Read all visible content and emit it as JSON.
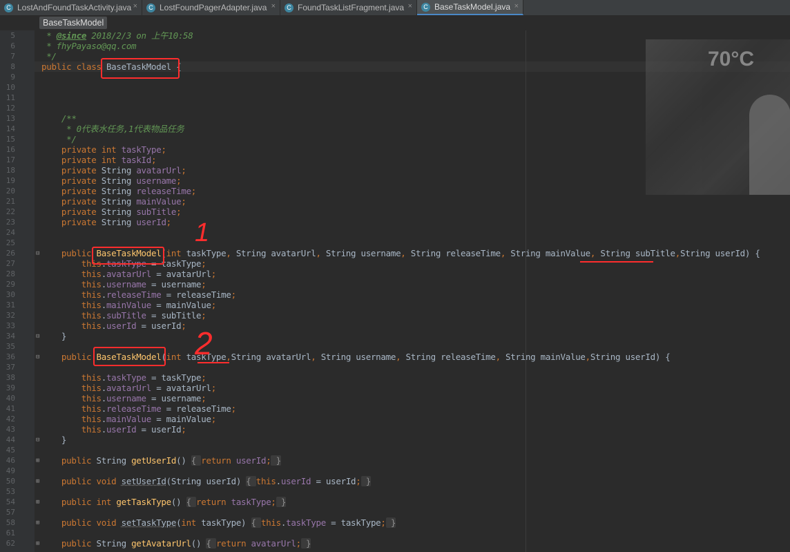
{
  "tabs": [
    {
      "label": "LostAndFoundTaskActivity.java",
      "icon": "C",
      "active": false
    },
    {
      "label": "LostFoundPagerAdapter.java",
      "icon": "C",
      "active": false
    },
    {
      "label": "FoundTaskListFragment.java",
      "icon": "C",
      "active": false
    },
    {
      "label": "BaseTaskModel.java",
      "icon": "C",
      "active": true
    }
  ],
  "tab_close_icon": "×",
  "breadcrumb": "BaseTaskModel",
  "background_image_text": "70°C",
  "annotations": {
    "mark_one": "1",
    "mark_two": "2"
  },
  "colors": {
    "keyword": "#cc7832",
    "field": "#9876aa",
    "method": "#ffc66d",
    "comment": "#629755",
    "annotation": "#ff2d2d"
  },
  "code_lines": [
    {
      "n": "5",
      "segs": [
        [
          "cm",
          " * "
        ],
        [
          "cmt",
          "@since"
        ],
        [
          "cm",
          " 2018/2/3 on 上午10:58"
        ]
      ]
    },
    {
      "n": "6",
      "segs": [
        [
          "cm",
          " * fhyPayaso@qq.com"
        ]
      ]
    },
    {
      "n": "7",
      "segs": [
        [
          "cm",
          " */"
        ]
      ]
    },
    {
      "n": "8",
      "segs": [
        [
          "kw",
          "public class "
        ],
        [
          "",
          "BaseTaskModel {"
        ]
      ]
    },
    {
      "n": "9",
      "segs": []
    },
    {
      "n": "10",
      "segs": []
    },
    {
      "n": "11",
      "segs": []
    },
    {
      "n": "12",
      "segs": []
    },
    {
      "n": "13",
      "segs": [
        [
          "cm",
          "    /**"
        ]
      ]
    },
    {
      "n": "14",
      "segs": [
        [
          "cm",
          "     * 0代表水任务,1代表物品任务"
        ]
      ]
    },
    {
      "n": "15",
      "segs": [
        [
          "cm",
          "     */"
        ]
      ]
    },
    {
      "n": "16",
      "segs": [
        [
          "kw",
          "    private int "
        ],
        [
          "fld",
          "taskType"
        ],
        [
          "kw",
          ";"
        ]
      ]
    },
    {
      "n": "17",
      "segs": [
        [
          "kw",
          "    private int "
        ],
        [
          "fld",
          "taskId"
        ],
        [
          "kw",
          ";"
        ]
      ]
    },
    {
      "n": "18",
      "segs": [
        [
          "kw",
          "    private "
        ],
        [
          "",
          "String "
        ],
        [
          "fld",
          "avatarUrl"
        ],
        [
          "kw",
          ";"
        ]
      ]
    },
    {
      "n": "19",
      "segs": [
        [
          "kw",
          "    private "
        ],
        [
          "",
          "String "
        ],
        [
          "fld",
          "username"
        ],
        [
          "kw",
          ";"
        ]
      ]
    },
    {
      "n": "20",
      "segs": [
        [
          "kw",
          "    private "
        ],
        [
          "",
          "String "
        ],
        [
          "fld",
          "releaseTime"
        ],
        [
          "kw",
          ";"
        ]
      ]
    },
    {
      "n": "21",
      "segs": [
        [
          "kw",
          "    private "
        ],
        [
          "",
          "String "
        ],
        [
          "fld",
          "mainValue"
        ],
        [
          "kw",
          ";"
        ]
      ]
    },
    {
      "n": "22",
      "segs": [
        [
          "kw",
          "    private "
        ],
        [
          "",
          "String "
        ],
        [
          "fld",
          "subTitle"
        ],
        [
          "kw",
          ";"
        ]
      ]
    },
    {
      "n": "23",
      "segs": [
        [
          "kw",
          "    private "
        ],
        [
          "",
          "String "
        ],
        [
          "fld",
          "userId"
        ],
        [
          "kw",
          ";"
        ]
      ]
    },
    {
      "n": "24",
      "segs": []
    },
    {
      "n": "25",
      "segs": []
    },
    {
      "n": "26",
      "segs": [
        [
          "kw",
          "    public "
        ],
        [
          "fn",
          "BaseTaskModel"
        ],
        [
          "",
          "("
        ],
        [
          "kw",
          "int "
        ],
        [
          "",
          "taskType"
        ],
        [
          "kw",
          ", "
        ],
        [
          "",
          "String avatarUrl"
        ],
        [
          "kw",
          ", "
        ],
        [
          "",
          "String username"
        ],
        [
          "kw",
          ", "
        ],
        [
          "",
          "String releaseTime"
        ],
        [
          "kw",
          ", "
        ],
        [
          "",
          "String mainValue"
        ],
        [
          "kw",
          ", "
        ],
        [
          "",
          "String subTitle"
        ],
        [
          "kw",
          ","
        ],
        [
          "",
          "String userId) {"
        ]
      ]
    },
    {
      "n": "27",
      "segs": [
        [
          "kw",
          "        this"
        ],
        [
          "",
          "."
        ],
        [
          "fld",
          "taskType"
        ],
        [
          "",
          " = taskType"
        ],
        [
          "kw",
          ";"
        ]
      ]
    },
    {
      "n": "28",
      "segs": [
        [
          "kw",
          "        this"
        ],
        [
          "",
          "."
        ],
        [
          "fld",
          "avatarUrl"
        ],
        [
          "",
          " = avatarUrl"
        ],
        [
          "kw",
          ";"
        ]
      ]
    },
    {
      "n": "29",
      "segs": [
        [
          "kw",
          "        this"
        ],
        [
          "",
          "."
        ],
        [
          "fld",
          "username"
        ],
        [
          "",
          " = username"
        ],
        [
          "kw",
          ";"
        ]
      ]
    },
    {
      "n": "30",
      "segs": [
        [
          "kw",
          "        this"
        ],
        [
          "",
          "."
        ],
        [
          "fld",
          "releaseTime"
        ],
        [
          "",
          " = releaseTime"
        ],
        [
          "kw",
          ";"
        ]
      ]
    },
    {
      "n": "31",
      "segs": [
        [
          "kw",
          "        this"
        ],
        [
          "",
          "."
        ],
        [
          "fld",
          "mainValue"
        ],
        [
          "",
          " = mainValue"
        ],
        [
          "kw",
          ";"
        ]
      ]
    },
    {
      "n": "32",
      "segs": [
        [
          "kw",
          "        this"
        ],
        [
          "",
          "."
        ],
        [
          "fld",
          "subTitle"
        ],
        [
          "",
          " = subTitle"
        ],
        [
          "kw",
          ";"
        ]
      ]
    },
    {
      "n": "33",
      "segs": [
        [
          "kw",
          "        this"
        ],
        [
          "",
          "."
        ],
        [
          "fld",
          "userId"
        ],
        [
          "",
          " = userId"
        ],
        [
          "kw",
          ";"
        ]
      ]
    },
    {
      "n": "34",
      "segs": [
        [
          "",
          "    }"
        ]
      ]
    },
    {
      "n": "35",
      "segs": []
    },
    {
      "n": "36",
      "segs": [
        [
          "kw",
          "    public "
        ],
        [
          "fn",
          "BaseTaskModel"
        ],
        [
          "",
          "("
        ],
        [
          "kw",
          "int "
        ],
        [
          "",
          "taskType"
        ],
        [
          "kw",
          ","
        ],
        [
          "",
          "String avatarUrl"
        ],
        [
          "kw",
          ", "
        ],
        [
          "",
          "String username"
        ],
        [
          "kw",
          ", "
        ],
        [
          "",
          "String releaseTime"
        ],
        [
          "kw",
          ", "
        ],
        [
          "",
          "String mainValue"
        ],
        [
          "kw",
          ","
        ],
        [
          "",
          "String userId) {"
        ]
      ]
    },
    {
      "n": "37",
      "segs": []
    },
    {
      "n": "38",
      "segs": [
        [
          "kw",
          "        this"
        ],
        [
          "",
          "."
        ],
        [
          "fld",
          "taskType"
        ],
        [
          "",
          " = taskType"
        ],
        [
          "kw",
          ";"
        ]
      ]
    },
    {
      "n": "39",
      "segs": [
        [
          "kw",
          "        this"
        ],
        [
          "",
          "."
        ],
        [
          "fld",
          "avatarUrl"
        ],
        [
          "",
          " = avatarUrl"
        ],
        [
          "kw",
          ";"
        ]
      ]
    },
    {
      "n": "40",
      "segs": [
        [
          "kw",
          "        this"
        ],
        [
          "",
          "."
        ],
        [
          "fld",
          "username"
        ],
        [
          "",
          " = username"
        ],
        [
          "kw",
          ";"
        ]
      ]
    },
    {
      "n": "41",
      "segs": [
        [
          "kw",
          "        this"
        ],
        [
          "",
          "."
        ],
        [
          "fld",
          "releaseTime"
        ],
        [
          "",
          " = releaseTime"
        ],
        [
          "kw",
          ";"
        ]
      ]
    },
    {
      "n": "42",
      "segs": [
        [
          "kw",
          "        this"
        ],
        [
          "",
          "."
        ],
        [
          "fld",
          "mainValue"
        ],
        [
          "",
          " = mainValue"
        ],
        [
          "kw",
          ";"
        ]
      ]
    },
    {
      "n": "43",
      "segs": [
        [
          "kw",
          "        this"
        ],
        [
          "",
          "."
        ],
        [
          "fld",
          "userId"
        ],
        [
          "",
          " = userId"
        ],
        [
          "kw",
          ";"
        ]
      ]
    },
    {
      "n": "44",
      "segs": [
        [
          "",
          "    }"
        ]
      ]
    },
    {
      "n": "45",
      "segs": []
    },
    {
      "n": "46",
      "segs": [
        [
          "kw",
          "    public "
        ],
        [
          "",
          "String "
        ],
        [
          "fn",
          "getUserId"
        ],
        [
          "",
          "() "
        ],
        [
          "fold",
          "{ "
        ],
        [
          "kw",
          "return "
        ],
        [
          "fld",
          "userId"
        ],
        [
          "kw",
          ";"
        ],
        [
          "fold",
          " }"
        ]
      ]
    },
    {
      "n": "49",
      "segs": []
    },
    {
      "n": "50",
      "segs": [
        [
          "kw",
          "    public void "
        ],
        [
          "uline",
          "setUserId"
        ],
        [
          "",
          "(String userId) "
        ],
        [
          "fold",
          "{ "
        ],
        [
          "kw",
          "this"
        ],
        [
          "",
          "."
        ],
        [
          "fld",
          "userId"
        ],
        [
          "",
          " = userId"
        ],
        [
          "kw",
          ";"
        ],
        [
          "fold",
          " }"
        ]
      ]
    },
    {
      "n": "53",
      "segs": []
    },
    {
      "n": "54",
      "segs": [
        [
          "kw",
          "    public int "
        ],
        [
          "fn",
          "getTaskType"
        ],
        [
          "",
          "() "
        ],
        [
          "fold",
          "{ "
        ],
        [
          "kw",
          "return "
        ],
        [
          "fld",
          "taskType"
        ],
        [
          "kw",
          ";"
        ],
        [
          "fold",
          " }"
        ]
      ]
    },
    {
      "n": "57",
      "segs": []
    },
    {
      "n": "58",
      "segs": [
        [
          "kw",
          "    public void "
        ],
        [
          "uline",
          "setTaskType"
        ],
        [
          "",
          "("
        ],
        [
          "kw",
          "int "
        ],
        [
          "",
          "taskType) "
        ],
        [
          "fold",
          "{ "
        ],
        [
          "kw",
          "this"
        ],
        [
          "",
          "."
        ],
        [
          "fld",
          "taskType"
        ],
        [
          "",
          " = taskType"
        ],
        [
          "kw",
          ";"
        ],
        [
          "fold",
          " }"
        ]
      ]
    },
    {
      "n": "61",
      "segs": []
    },
    {
      "n": "62",
      "segs": [
        [
          "kw",
          "    public "
        ],
        [
          "",
          "String "
        ],
        [
          "fn",
          "getAvatarUrl"
        ],
        [
          "",
          "() "
        ],
        [
          "fold",
          "{ "
        ],
        [
          "kw",
          "return "
        ],
        [
          "fld",
          "avatarUrl"
        ],
        [
          "kw",
          ";"
        ],
        [
          "fold",
          " }"
        ]
      ]
    }
  ]
}
